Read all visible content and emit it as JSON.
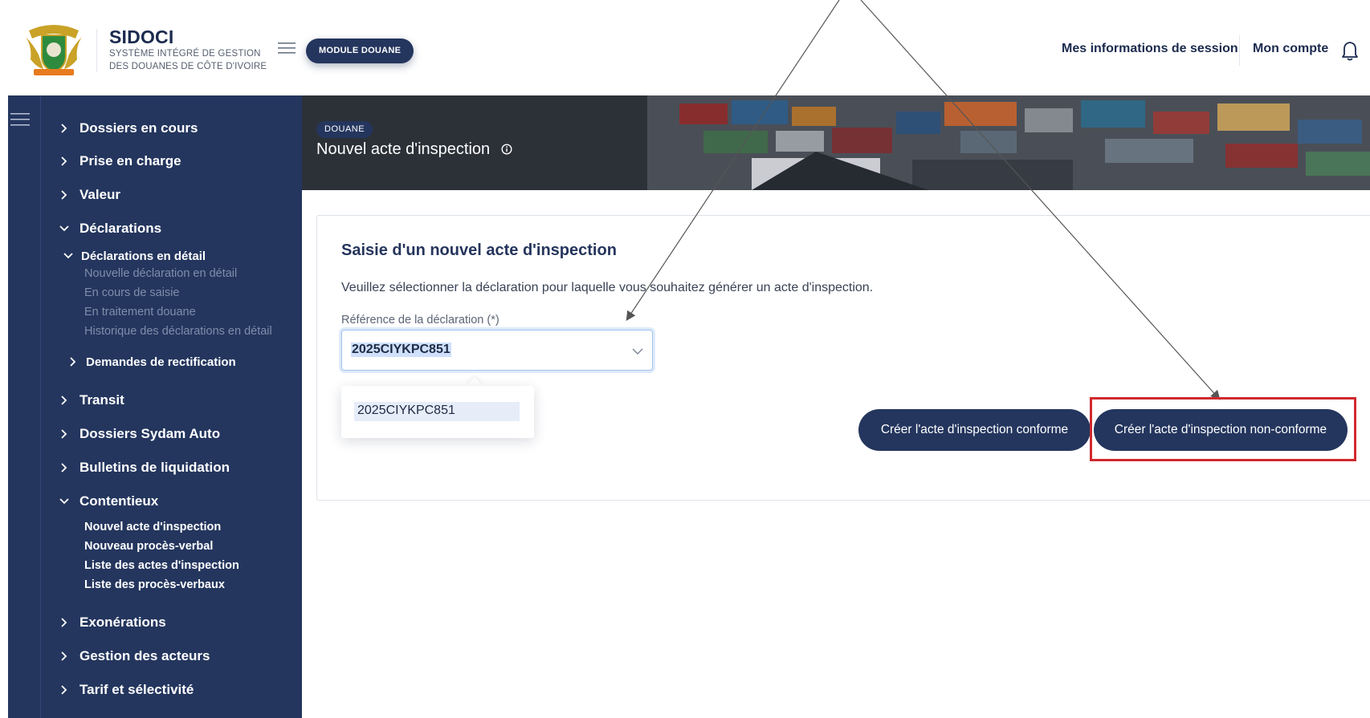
{
  "header": {
    "brand_title": "SIDOCI",
    "brand_sub_line1": "SYSTÈME INTÉGRÉ DE GESTION",
    "brand_sub_line2": "DES DOUANES DE CÔTE D'IVOIRE",
    "module_label": "MODULE DOUANE",
    "session_link": "Mes informations de session",
    "account_link": "Mon compte"
  },
  "sidebar": {
    "items": [
      {
        "label": "Dossiers en cours"
      },
      {
        "label": "Prise en charge"
      },
      {
        "label": "Valeur"
      },
      {
        "label": "Déclarations"
      },
      {
        "label": "Transit"
      },
      {
        "label": "Dossiers Sydam Auto"
      },
      {
        "label": "Bulletins de liquidation"
      },
      {
        "label": "Contentieux"
      },
      {
        "label": "Exonérations"
      },
      {
        "label": "Gestion des acteurs"
      },
      {
        "label": "Tarif et sélectivité"
      }
    ],
    "declarations_sub": {
      "group_label": "Déclarations en détail",
      "leaves": [
        "Nouvelle déclaration en détail",
        "En cours de saisie",
        "En traitement douane",
        "Historique des déclarations en détail"
      ],
      "rectification_label": "Demandes de rectification"
    },
    "contentieux_leaves": [
      "Nouvel acte d'inspection",
      "Nouveau procès-verbal",
      "Liste des actes d'inspection",
      "Liste des procès-verbaux"
    ]
  },
  "banner": {
    "tag": "DOUANE",
    "title": "Nouvel acte d'inspection"
  },
  "form": {
    "title": "Saisie d'un nouvel acte d'inspection",
    "description": "Veuillez sélectionner la déclaration pour laquelle vous souhaitez générer un acte d'inspection.",
    "field_label": "Référence de la déclaration (*)",
    "selected_value": "2025CIYKPC851",
    "options": [
      "2025CIYKPC851"
    ],
    "btn_conforme": "Créer l'acte d'inspection conforme",
    "btn_non_conforme": "Créer l'acte d'inspection non-conforme"
  },
  "colors": {
    "navy": "#24365e",
    "annotation_red": "#d0292e"
  }
}
